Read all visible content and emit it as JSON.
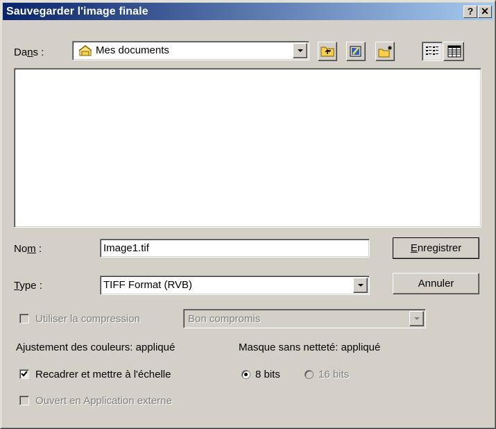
{
  "window": {
    "title": "Sauvegarder l'image finale",
    "help_glyph": "?",
    "close_glyph": "✕"
  },
  "dans": {
    "label_pre": "Da",
    "label_u": "n",
    "label_post": "s :",
    "folder": "Mes documents"
  },
  "toolbar": {
    "icons": [
      "folder-up-icon",
      "desktop-icon",
      "new-folder-icon",
      "list-view-icon",
      "details-view-icon"
    ]
  },
  "nom": {
    "label_pre": "No",
    "label_u": "m",
    "label_post": " :",
    "value": "Image1.tif"
  },
  "type": {
    "label_u": "T",
    "label_post": "ype :",
    "value": "TIFF Format (RVB)"
  },
  "buttons": {
    "save_u": "E",
    "save_post": "nregistrer",
    "cancel": "Annuler"
  },
  "compression": {
    "checkbox_label": "Utiliser la compression",
    "checked": false,
    "select_value": "Bon compromis"
  },
  "info": {
    "color_adjust": "Ajustement des couleurs: appliqué",
    "unsharp_mask": "Masque sans netteté: appliqué"
  },
  "options": {
    "crop_scale_label": "Recadrer et mettre à l'échelle",
    "crop_scale_checked": true,
    "external_app_label": "Ouvert en Application externe",
    "external_app_checked": false
  },
  "bits": {
    "option_8": "8 bits",
    "option_16": "16 bits",
    "selected": "8 bits"
  }
}
